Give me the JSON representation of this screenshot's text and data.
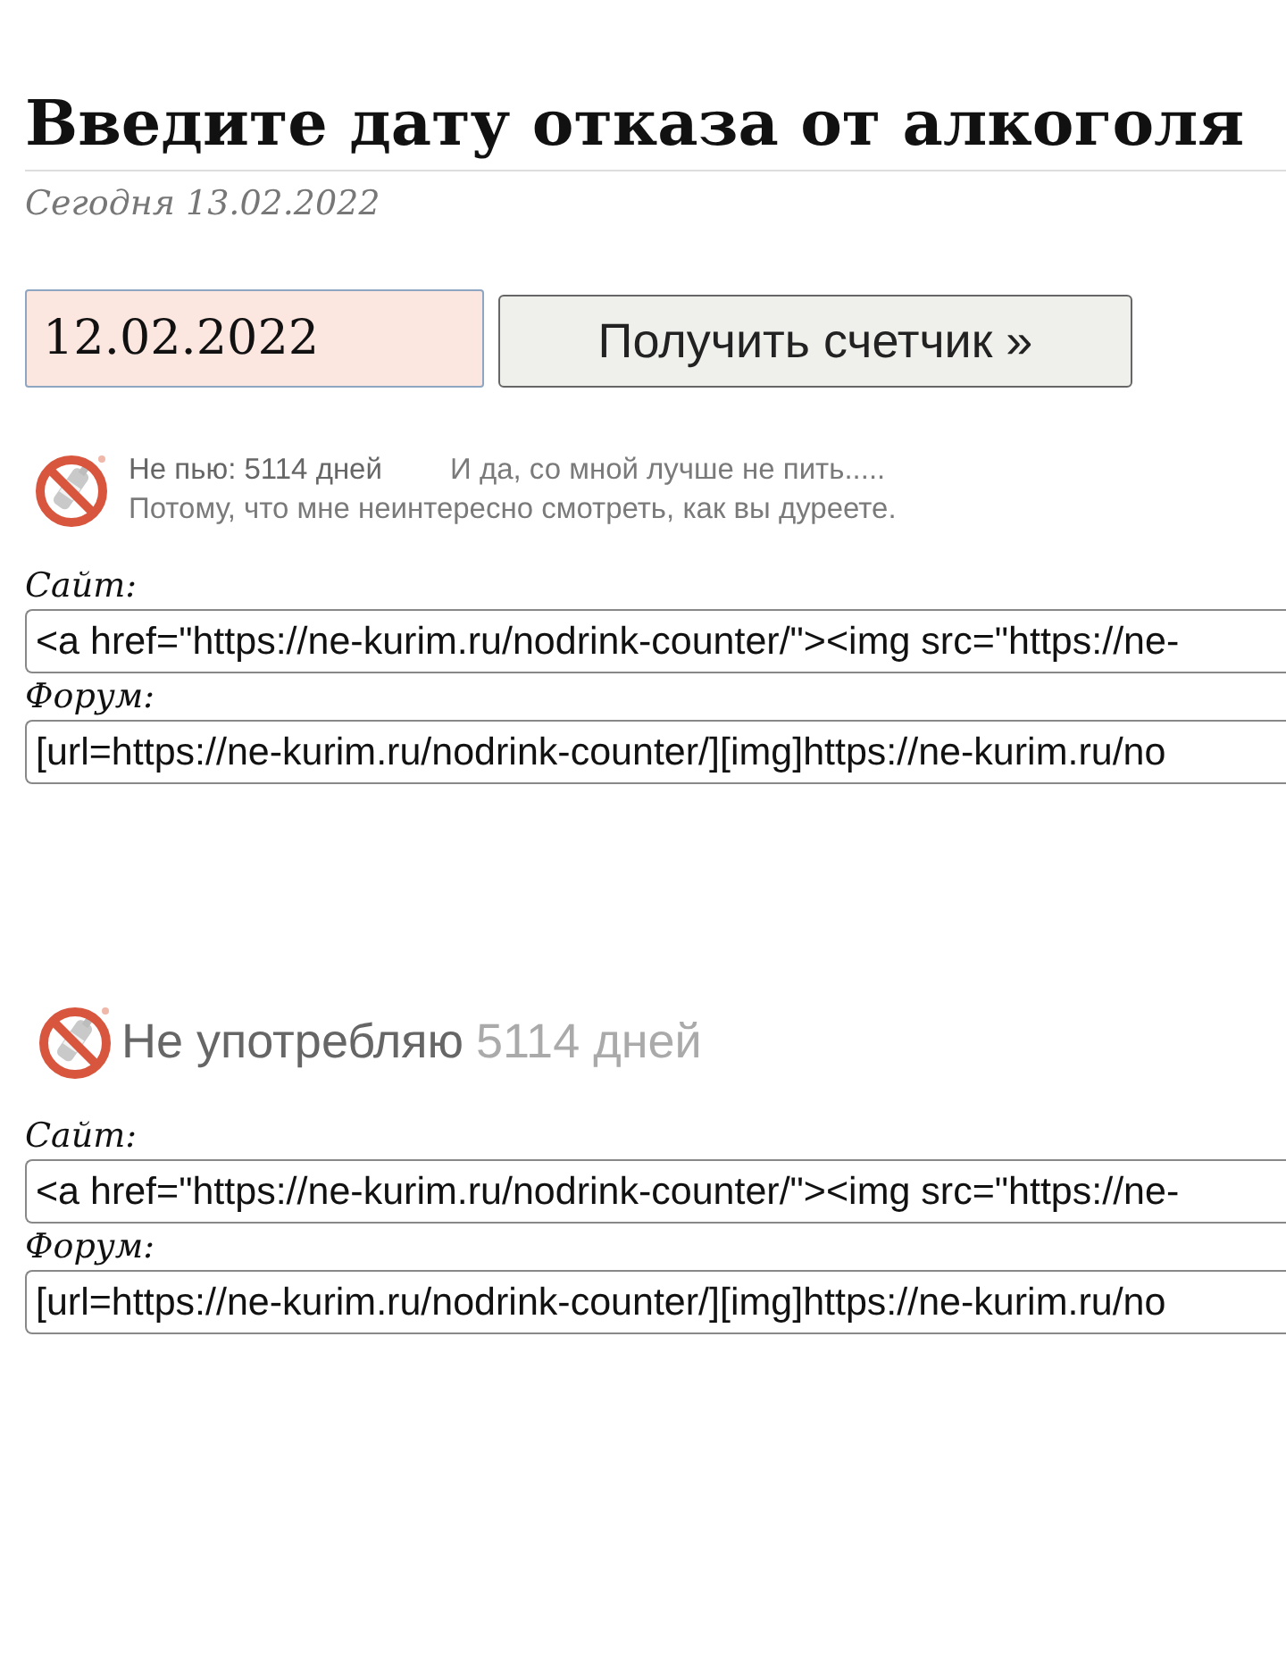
{
  "heading": {
    "title": "Введите дату отказа от алкоголя",
    "today": "Сегодня 13.02.2022"
  },
  "form": {
    "date_field": {
      "value": "12.02.2022"
    },
    "button": "Получить счетчик »"
  },
  "counters": [
    {
      "kind": "banner",
      "days_text": "Не пью: 5114 дней",
      "slogan": "И да, со мной лучше не пить.....",
      "caption": "Потому, что мне неинтересно смотреть, как вы дуреете.",
      "codes": [
        {
          "label": "Сайт:",
          "value": "<a href=\"https://ne-kurim.ru/nodrink-counter/\"><img src=\"https://ne-"
        },
        {
          "label": "Форум:",
          "value": "[url=https://ne-kurim.ru/nodrink-counter/][img]https://ne-kurim.ru/no"
        }
      ]
    },
    {
      "kind": "compact",
      "lead": "Не употребляю",
      "count": "5114 дней",
      "codes": [
        {
          "label": "Сайт:",
          "value": "<a href=\"https://ne-kurim.ru/nodrink-counter/\"><img src=\"https://ne-"
        },
        {
          "label": "Форум:",
          "value": "[url=https://ne-kurim.ru/nodrink-counter/][img]https://ne-kurim.ru/no"
        }
      ]
    }
  ]
}
